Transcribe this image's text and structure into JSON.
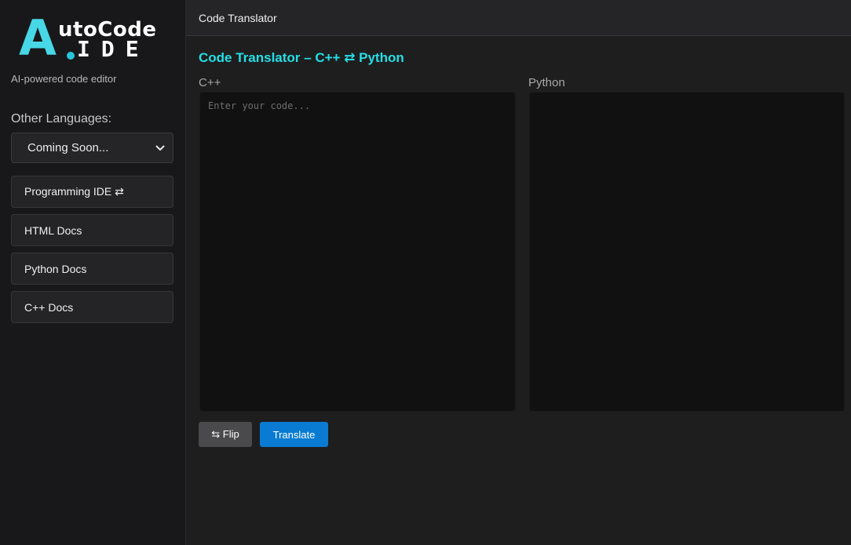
{
  "sidebar": {
    "logo": {
      "big_letter": "A",
      "top_text": "utoCode",
      "bottom_text": "IDE"
    },
    "tagline": "AI-powered code editor",
    "other_languages_label": "Other Languages:",
    "language_select": {
      "selected": "Coming Soon..."
    },
    "items": [
      {
        "label": "Programming IDE ⇄"
      },
      {
        "label": "HTML Docs"
      },
      {
        "label": "Python Docs"
      },
      {
        "label": "C++ Docs"
      }
    ]
  },
  "topbar": {
    "title": "Code Translator"
  },
  "main": {
    "title": "Code Translator – C++ ⇄ Python",
    "source": {
      "label": "C++",
      "placeholder": "Enter your code...",
      "value": ""
    },
    "target": {
      "label": "Python",
      "value": ""
    },
    "buttons": {
      "flip_label": "⇆ Flip",
      "translate_label": "Translate"
    }
  },
  "colors": {
    "accent": "#25dfe6",
    "logo": "#47d7e6",
    "primary_button": "#0a7bd2",
    "secondary_button": "#4a4a4c"
  }
}
